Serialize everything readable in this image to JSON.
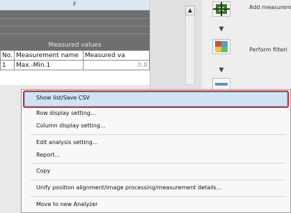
{
  "sheet": {
    "column_letter": "F",
    "section_title": "Measured values",
    "columns": [
      "No.",
      "Measurement name",
      "Measured va"
    ],
    "rows": [
      [
        "1",
        "Max.-Min.1",
        "0.8"
      ]
    ]
  },
  "scrollbar": {
    "up_arrow": "▲"
  },
  "procedure": {
    "steps": [
      {
        "label": "Add measurem",
        "icon": "add-measurement-icon"
      },
      {
        "label": "Perform filteri",
        "icon": "perform-filter-icon"
      },
      {
        "label": "",
        "icon": "next-step-icon"
      }
    ],
    "arrow_glyph": "▼"
  },
  "context_menu": {
    "items": [
      "Show list/Save CSV",
      "Row display setting...",
      "Column display setting...",
      "Edit analysis setting...",
      "Report...",
      "Copy",
      "Unify position alignment/image processing/measurement details...",
      "Move to new Analyzer"
    ],
    "highlighted_index": 0
  },
  "colors": {
    "highlight_frame": "#d5262c",
    "selection": "#cfe3f5",
    "section_band": "#6f6f6f"
  }
}
